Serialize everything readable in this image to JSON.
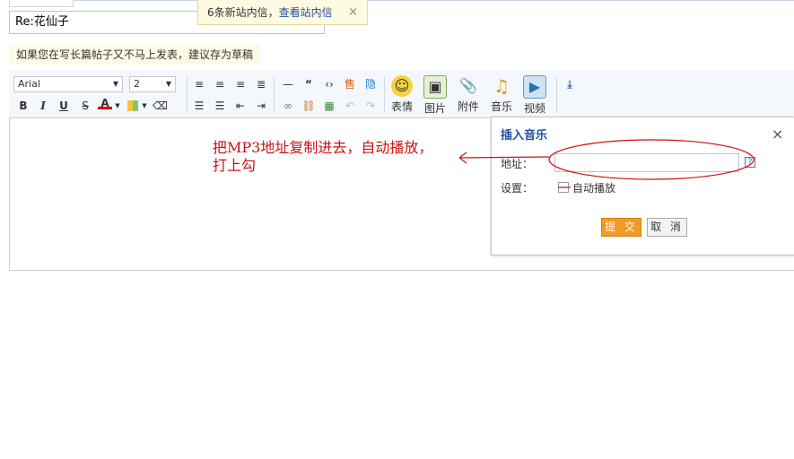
{
  "subject": {
    "value": "Re:花仙子"
  },
  "notification": {
    "count_text": "6条新站内信，",
    "link": "查看站内信",
    "close": "×"
  },
  "tip": "如果您在写长篇帖子又不马上发表，建议存为草稿",
  "toolbar": {
    "font_select": "Arial",
    "size_select": "2",
    "buttons": {
      "emotion": "表情",
      "image": "图片",
      "attach": "附件",
      "music": "音乐",
      "video": "视频"
    }
  },
  "music_dialog": {
    "title": "插入音乐",
    "address_label": "地址：",
    "address_value": "",
    "settings_label": "设置：",
    "autoplay_label": "自动播放",
    "submit": "提 交",
    "cancel": "取 消"
  },
  "annotation": {
    "line1": "把MP3地址复制进去，自动播放，",
    "line2": "打上勾"
  },
  "colors": {
    "accent": "#1f4e9e",
    "annotation": "#cc1111",
    "submit": "#f19a26"
  }
}
